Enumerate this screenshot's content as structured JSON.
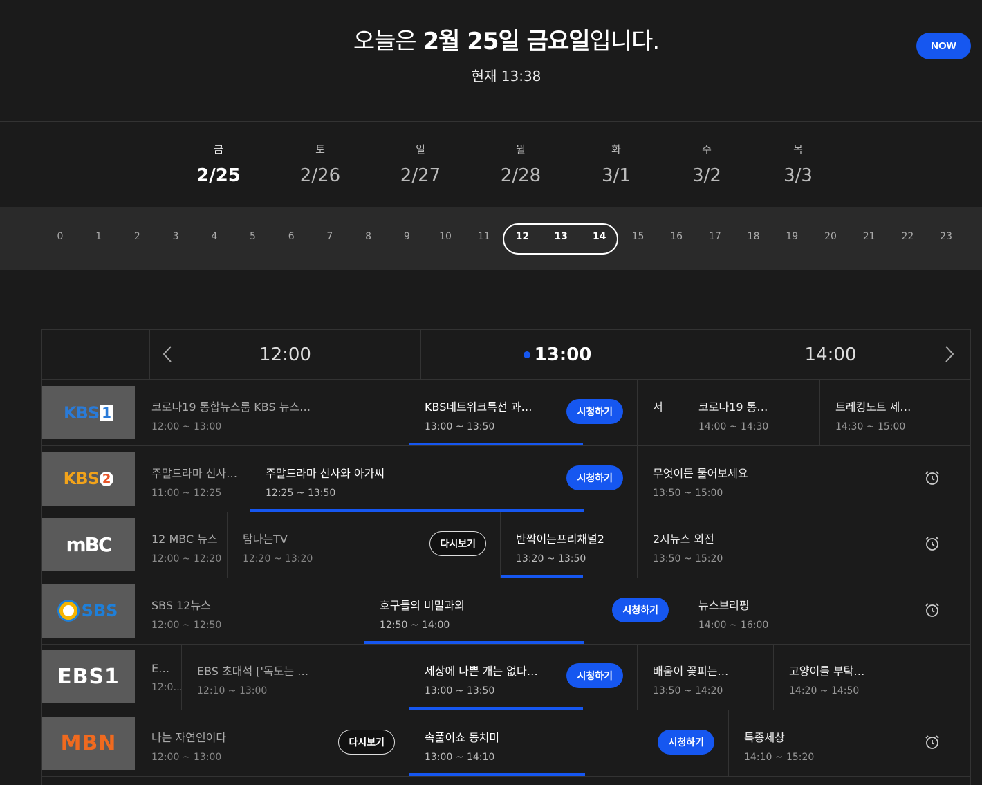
{
  "header": {
    "prefix": "오늘은 ",
    "date_bold": "2월 25일 금요일",
    "suffix": "입니다.",
    "current_time": "현재 13:38",
    "now_button": "NOW"
  },
  "days": [
    {
      "dow": "금",
      "date": "2/25",
      "active": true
    },
    {
      "dow": "토",
      "date": "2/26"
    },
    {
      "dow": "일",
      "date": "2/27"
    },
    {
      "dow": "월",
      "date": "2/28"
    },
    {
      "dow": "화",
      "date": "3/1"
    },
    {
      "dow": "수",
      "date": "3/2"
    },
    {
      "dow": "목",
      "date": "3/3"
    }
  ],
  "hours": [
    "0",
    "1",
    "2",
    "3",
    "4",
    "5",
    "6",
    "7",
    "8",
    "9",
    "10",
    "11",
    "12",
    "13",
    "14",
    "15",
    "16",
    "17",
    "18",
    "19",
    "20",
    "21",
    "22",
    "23"
  ],
  "selected_hours": [
    "12",
    "13",
    "14"
  ],
  "timeline": {
    "slots": [
      "12:00",
      "13:00",
      "14:00"
    ],
    "current_slot": "13:00",
    "prev_icon": "chevron-left-icon",
    "next_icon": "chevron-right-icon"
  },
  "buttons": {
    "watch": "시청하기",
    "replay": "다시보기"
  },
  "colors": {
    "accent": "#1657f0",
    "background": "#1b1b1b"
  },
  "channels": [
    {
      "name": "KBS1",
      "programs": [
        {
          "title": "코로나19 통합뉴스룸 KBS 뉴스…",
          "time": "12:00 ~ 13:00"
        },
        {
          "title": "KBS네트워크특선 과…",
          "time": "13:00 ~ 13:50",
          "watch": true,
          "progress": 0.76
        },
        {
          "title": "서",
          "time": ""
        },
        {
          "title": "코로나19 통…",
          "time": "14:00 ~ 14:30"
        },
        {
          "title": "트레킹노트 세…",
          "time": "14:30 ~ 15:00"
        }
      ]
    },
    {
      "name": "KBS2",
      "programs": [
        {
          "title": "주말드라마 신사…",
          "time": "11:00 ~ 12:25"
        },
        {
          "title": "주말드라마 신사와 아가씨",
          "time": "12:25 ~ 13:50",
          "watch": true,
          "progress": 0.86
        },
        {
          "title": "무엇이든 물어보세요",
          "time": "13:50 ~ 15:00",
          "alarm": true
        }
      ]
    },
    {
      "name": "MBC",
      "programs": [
        {
          "title": "12 MBC 뉴스",
          "time": "12:00 ~ 12:20"
        },
        {
          "title": "탐나는TV",
          "time": "12:20 ~ 13:20",
          "replay": true
        },
        {
          "title": "반짝이는프리채널2",
          "time": "13:20 ~ 13:50",
          "progress": 0.6
        },
        {
          "title": "2시뉴스 외전",
          "time": "13:50 ~ 15:20",
          "alarm": true
        }
      ]
    },
    {
      "name": "SBS",
      "programs": [
        {
          "title": "SBS 12뉴스",
          "time": "12:00 ~ 12:50"
        },
        {
          "title": "호구들의 비밀과외",
          "time": "12:50 ~ 14:00",
          "watch": true,
          "progress": 0.69
        },
        {
          "title": "뉴스브리핑",
          "time": "14:00 ~ 16:00",
          "alarm": true
        }
      ]
    },
    {
      "name": "EBS1",
      "programs": [
        {
          "title": "E…",
          "time": "12:0…"
        },
        {
          "title": "EBS 초대석 ['독도는 …",
          "time": "12:10 ~ 13:00"
        },
        {
          "title": "세상에 나쁜 개는 없다…",
          "time": "13:00 ~ 13:50",
          "watch": true,
          "progress": 0.76
        },
        {
          "title": "배움이 꽃피는…",
          "time": "13:50 ~ 14:20"
        },
        {
          "title": "고양이를 부탁…",
          "time": "14:20 ~ 14:50"
        }
      ]
    },
    {
      "name": "MBN",
      "programs": [
        {
          "title": "나는 자연인이다",
          "time": "12:00 ~ 13:00",
          "replay": true
        },
        {
          "title": "속풀이쇼 동치미",
          "time": "13:00 ~ 14:10",
          "watch": true,
          "progress": 0.55
        },
        {
          "title": "특종세상",
          "time": "14:10 ~ 15:20",
          "alarm": true
        }
      ]
    }
  ]
}
